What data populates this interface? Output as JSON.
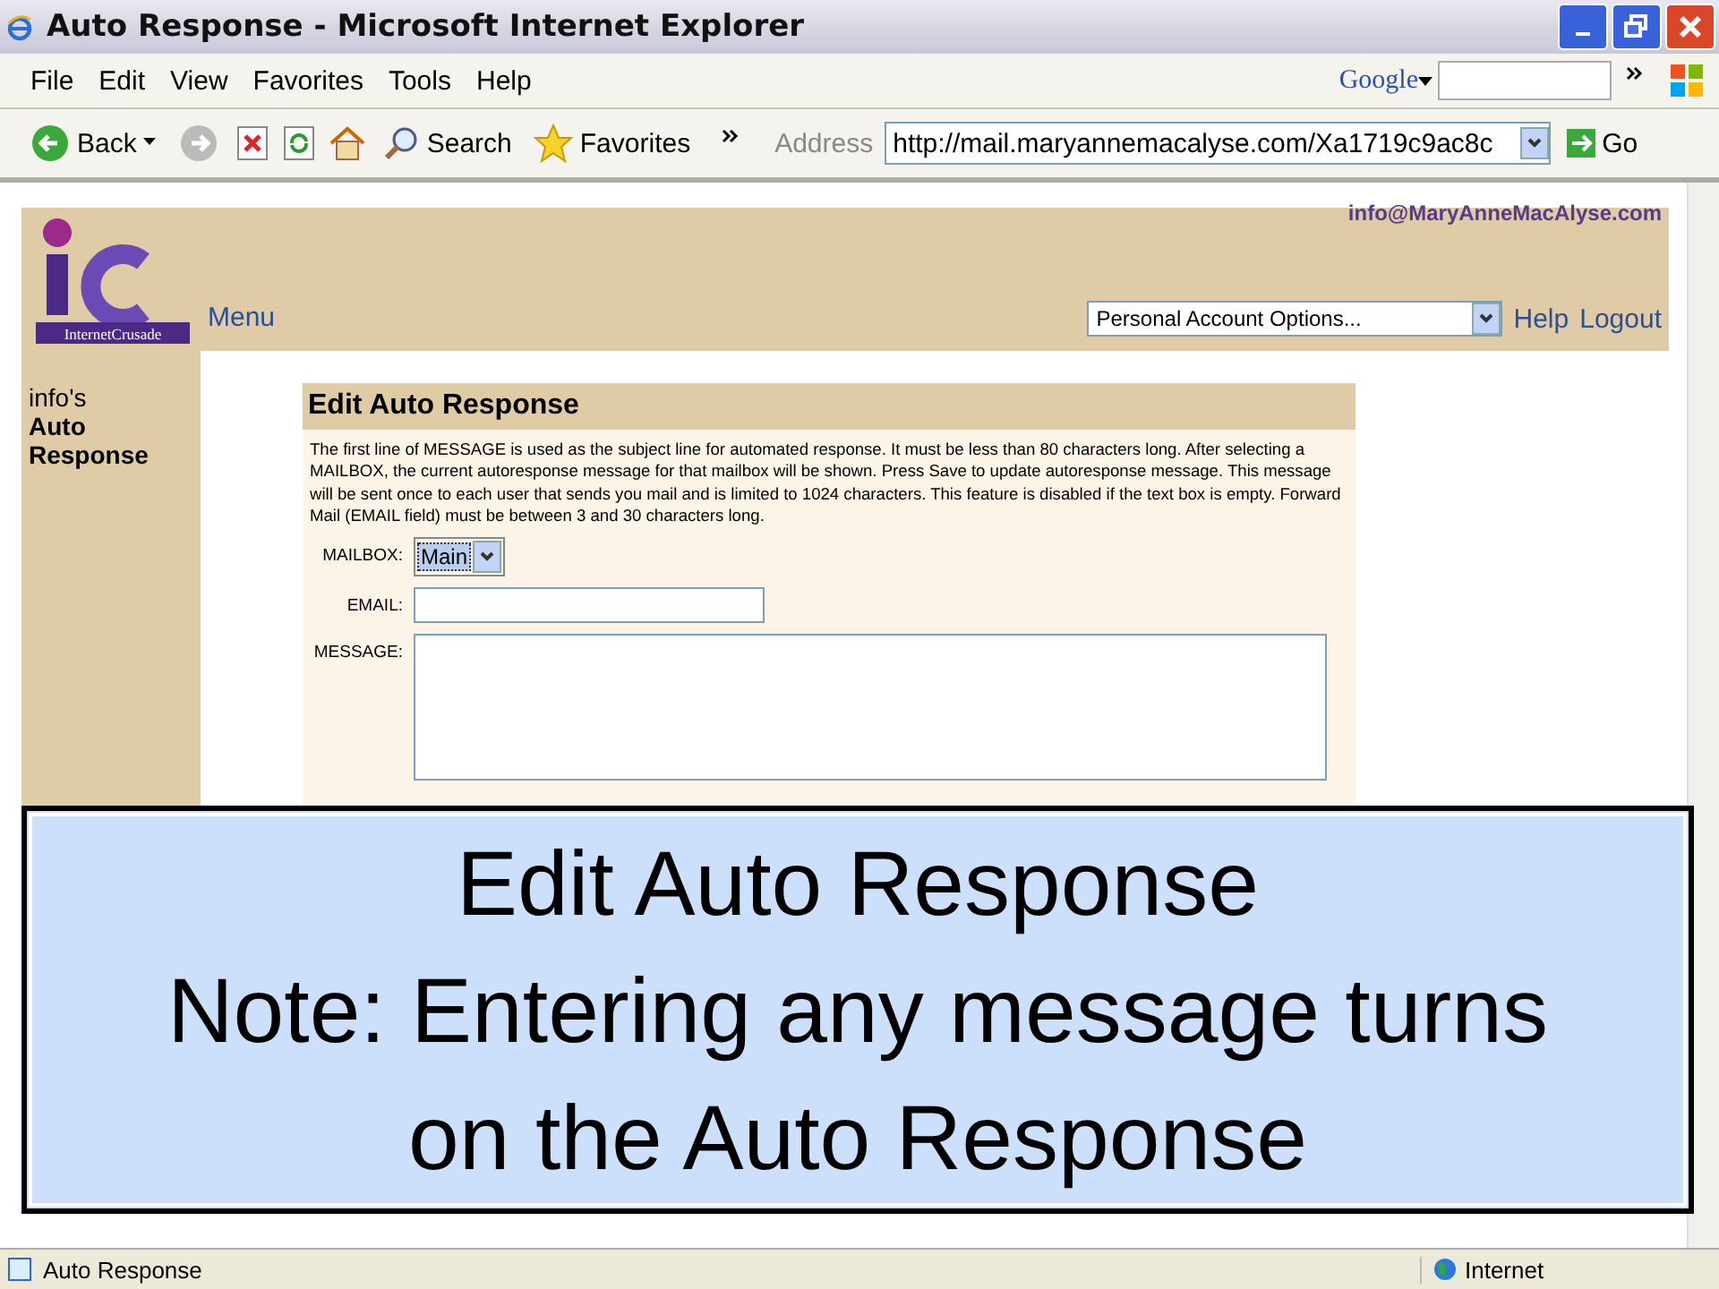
{
  "window": {
    "title": "Auto Response - Microsoft Internet Explorer"
  },
  "menu_bar": [
    "File",
    "Edit",
    "View",
    "Favorites",
    "Tools",
    "Help"
  ],
  "google_bar": {
    "label": "Google"
  },
  "toolbar": {
    "back": "Back",
    "search": "Search",
    "favorites": "Favorites",
    "address_label": "Address",
    "address": "http://mail.maryannemacalyse.com/Xa1719c9ac8c",
    "go": "Go"
  },
  "site_header": {
    "logo_text": "InternetCrusade",
    "email": "info@MaryAnneMacAlyse.com",
    "menu_link": "Menu",
    "account_select": "Personal Account Options...",
    "links": [
      "Help",
      "Logout"
    ]
  },
  "sidebar": {
    "owner": "info's",
    "section": "Auto Response"
  },
  "panel": {
    "title": "Edit Auto Response",
    "description": "The first line of MESSAGE is used as the subject line for automated response. It must be less than 80 characters long. After selecting a MAILBOX, the current autoresponse message for that mailbox will be shown. Press Save to update autoresponse message. This message will be sent once to each user that sends you mail and is limited to 1024 characters. This feature is disabled if the text box is empty. Forward Mail (EMAIL field) must be between 3 and 30 characters long.",
    "fields": [
      {
        "kind": "select",
        "label": "MAILBOX:",
        "value": "Main"
      },
      {
        "kind": "text",
        "label": "EMAIL:"
      },
      {
        "kind": "textarea",
        "label": "MESSAGE:"
      }
    ]
  },
  "caption": {
    "lines": [
      "Edit Auto Response",
      "Note: Entering any message turns",
      "on the Auto Response"
    ]
  },
  "status_bar": {
    "text": "Auto Response",
    "zone": "Internet"
  }
}
